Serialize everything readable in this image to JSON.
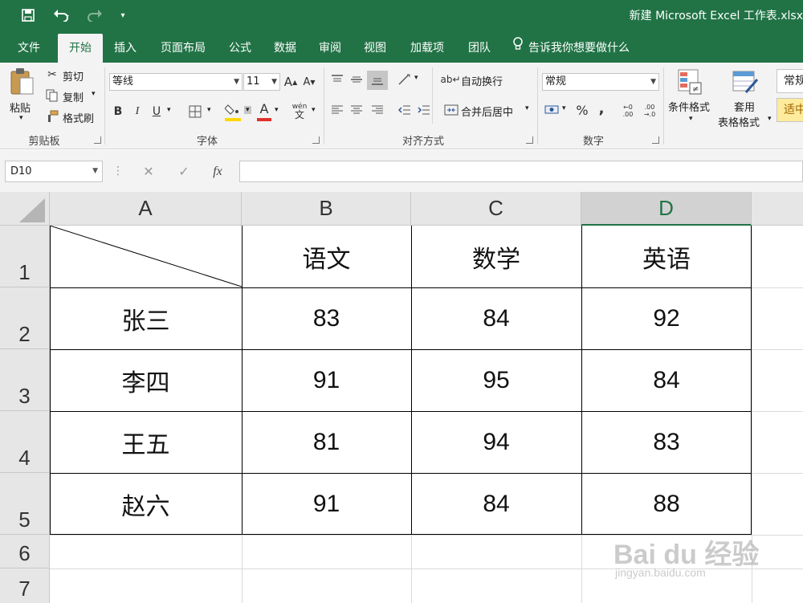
{
  "titlebar": {
    "doc_title": "新建 Microsoft Excel 工作表.xlsx"
  },
  "tabs": [
    {
      "label": "文件"
    },
    {
      "label": "开始"
    },
    {
      "label": "插入"
    },
    {
      "label": "页面布局"
    },
    {
      "label": "公式"
    },
    {
      "label": "数据"
    },
    {
      "label": "审阅"
    },
    {
      "label": "视图"
    },
    {
      "label": "加载项"
    },
    {
      "label": "团队"
    }
  ],
  "tell_me": "告诉我你想要做什么",
  "ribbon": {
    "clipboard": {
      "paste": "粘贴",
      "cut": "剪切",
      "copy": "复制",
      "format_painter": "格式刷",
      "group_label": "剪贴板"
    },
    "font": {
      "font_name": "等线",
      "font_size": "11",
      "grow": "A",
      "shrink": "A",
      "bold": "B",
      "italic": "I",
      "underline": "U",
      "font_color_letter": "A",
      "phonetic": "wén",
      "group_label": "字体"
    },
    "alignment": {
      "wrap_text": "自动换行",
      "merge_center": "合并后居中",
      "group_label": "对齐方式"
    },
    "number": {
      "format": "常规",
      "percent": "%",
      "comma": ",",
      "inc_decimal_top": "←0",
      "inc_decimal_bottom": ".00",
      "dec_decimal_top": ".00",
      "dec_decimal_bottom": "→.0",
      "group_label": "数字"
    },
    "styles": {
      "conditional_format": "条件格式",
      "table_format_line1": "套用",
      "table_format_line2": "表格格式",
      "style_normal": "常规",
      "style_neutral": "适中"
    }
  },
  "formula_bar": {
    "name_box": "D10",
    "cancel": "✕",
    "enter": "✓",
    "fx": "fx",
    "value": ""
  },
  "columns": [
    "A",
    "B",
    "C",
    "D"
  ],
  "rows": [
    "1",
    "2",
    "3",
    "4",
    "5",
    "6",
    "7"
  ],
  "table": {
    "header": [
      "",
      "语文",
      "数学",
      "英语"
    ],
    "data": [
      [
        "张三",
        "83",
        "84",
        "92"
      ],
      [
        "李四",
        "91",
        "95",
        "84"
      ],
      [
        "王五",
        "81",
        "94",
        "83"
      ],
      [
        "赵六",
        "91",
        "84",
        "88"
      ]
    ]
  },
  "watermark": {
    "brand": "Bai du 经验",
    "url": "jingyan.baidu.com"
  },
  "colors": {
    "excel_green": "#217346",
    "ribbon_bg": "#f3f3f3",
    "fill_yellow": "#ffd700",
    "font_red": "#e0302a",
    "neutral_style": "#ffeb9c"
  }
}
